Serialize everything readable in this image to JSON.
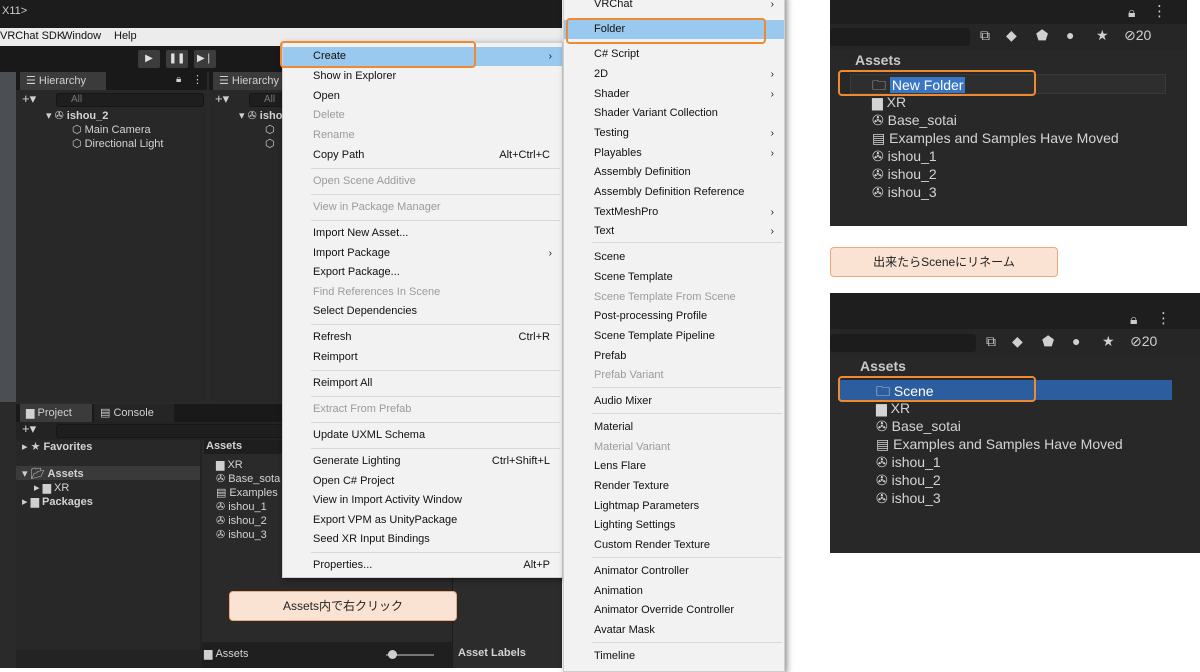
{
  "editor": {
    "title": "X11>",
    "menu": [
      "VRChat SDK",
      "Window",
      "Help"
    ],
    "hierarchy_left": {
      "tab": "Hierarchy",
      "search_placeholder": "All",
      "scene": "ishou_2",
      "children": [
        "Main Camera",
        "Directional Light"
      ]
    },
    "hierarchy_right": {
      "tab": "Hierarchy",
      "search_placeholder": "All",
      "scene": "ishou"
    },
    "project": {
      "tabs": [
        "Project",
        "Console"
      ],
      "tree": {
        "favorites": "Favorites",
        "assets": "Assets",
        "assets_child": "XR",
        "packages": "Packages"
      },
      "assets_header": "Assets",
      "assets_items": [
        "XR",
        "Base_sota",
        "Examples",
        "ishou_1",
        "ishou_2",
        "ishou_3"
      ],
      "footer_path": "Assets",
      "asset_labels": "Asset Labels"
    }
  },
  "context_menu": {
    "items": [
      {
        "label": "Create",
        "arrow": "›",
        "highlighted": true
      },
      {
        "label": "Show in Explorer"
      },
      {
        "label": "Open"
      },
      {
        "label": "Delete",
        "disabled": true
      },
      {
        "label": "Rename",
        "disabled": true
      },
      {
        "label": "Copy Path",
        "shortcut": "Alt+Ctrl+C"
      },
      {
        "label": "Open Scene Additive",
        "disabled": true
      },
      {
        "label": "View in Package Manager",
        "disabled": true
      },
      {
        "label": "Import New Asset..."
      },
      {
        "label": "Import Package",
        "arrow": "›"
      },
      {
        "label": "Export Package..."
      },
      {
        "label": "Find References In Scene",
        "disabled": true
      },
      {
        "label": "Select Dependencies"
      },
      {
        "label": "Refresh",
        "shortcut": "Ctrl+R"
      },
      {
        "label": "Reimport"
      },
      {
        "label": "Reimport All"
      },
      {
        "label": "Extract From Prefab",
        "disabled": true
      },
      {
        "label": "Update UXML Schema"
      },
      {
        "label": "Generate Lighting",
        "shortcut": "Ctrl+Shift+L"
      },
      {
        "label": "Open C# Project"
      },
      {
        "label": "View in Import Activity Window"
      },
      {
        "label": "Export VPM as UnityPackage"
      },
      {
        "label": "Seed XR Input Bindings"
      },
      {
        "label": "Properties...",
        "shortcut": "Alt+P"
      }
    ]
  },
  "create_submenu": {
    "items": [
      {
        "label": "VRChat",
        "arrow": "›"
      },
      {
        "label": "Folder",
        "highlighted": true
      },
      {
        "label": "C# Script"
      },
      {
        "label": "2D",
        "arrow": "›"
      },
      {
        "label": "Shader",
        "arrow": "›"
      },
      {
        "label": "Shader Variant Collection"
      },
      {
        "label": "Testing",
        "arrow": "›"
      },
      {
        "label": "Playables",
        "arrow": "›"
      },
      {
        "label": "Assembly Definition"
      },
      {
        "label": "Assembly Definition Reference"
      },
      {
        "label": "TextMeshPro",
        "arrow": "›"
      },
      {
        "label": "Text",
        "arrow": "›"
      },
      {
        "label": "Scene"
      },
      {
        "label": "Scene Template"
      },
      {
        "label": "Scene Template From Scene",
        "disabled": true
      },
      {
        "label": "Post-processing Profile"
      },
      {
        "label": "Scene Template Pipeline"
      },
      {
        "label": "Prefab"
      },
      {
        "label": "Prefab Variant",
        "disabled": true
      },
      {
        "label": "Audio Mixer"
      },
      {
        "label": "Material"
      },
      {
        "label": "Material Variant",
        "disabled": true
      },
      {
        "label": "Lens Flare"
      },
      {
        "label": "Render Texture"
      },
      {
        "label": "Lightmap Parameters"
      },
      {
        "label": "Lighting Settings"
      },
      {
        "label": "Custom Render Texture"
      },
      {
        "label": "Animator Controller"
      },
      {
        "label": "Animation"
      },
      {
        "label": "Animator Override Controller"
      },
      {
        "label": "Avatar Mask"
      },
      {
        "label": "Timeline"
      }
    ]
  },
  "notes": {
    "right_click": "Assets内で右クリック",
    "rename": "出来たらSceneにリネーム"
  },
  "zoom_top": {
    "toolbar_count": "20",
    "header": "Assets",
    "items": [
      "New Folder",
      "XR",
      "Base_sotai",
      "Examples and Samples Have Moved",
      "ishou_1",
      "ishou_2",
      "ishou_3"
    ]
  },
  "zoom_bottom": {
    "toolbar_count": "20",
    "header": "Assets",
    "items": [
      "Scene",
      "XR",
      "Base_sotai",
      "Examples and Samples Have Moved",
      "ishou_1",
      "ishou_2",
      "ishou_3"
    ]
  },
  "colors": {
    "highlight_orange": "#f08a30",
    "menu_highlight": "#99c9ef",
    "selection_blue": "#2c5d9e",
    "note_fill": "#fbe3d3"
  }
}
